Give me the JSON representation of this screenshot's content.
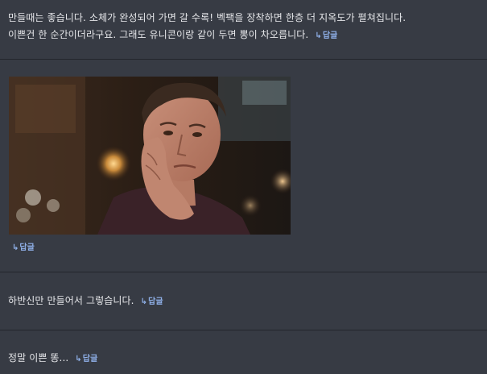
{
  "comments": [
    {
      "line1": "만들때는 좋습니다. 소체가 완성되어 가면 갈 수록! 벡팩을 장착하면 한층 더 지옥도가 펼쳐집니다.",
      "line2": "이쁜건 한 순간이더라구요. 그래도 유니콘이랑 같이 두면 뽕이 차오릅니다.",
      "reply_label": "답글"
    },
    {
      "image_icon": "gif-image",
      "reply_label": "답글"
    },
    {
      "text": "하반신만 만들어서 그렇습니다.",
      "reply_label": "답글"
    },
    {
      "text": "정말 이쁜 똥...",
      "reply_label": "답글"
    }
  ],
  "reply_arrow": "↳",
  "colors": {
    "background": "#373b44",
    "divider": "#23262c",
    "text": "#e6e7ea",
    "reply_link": "#8fb0e8"
  }
}
